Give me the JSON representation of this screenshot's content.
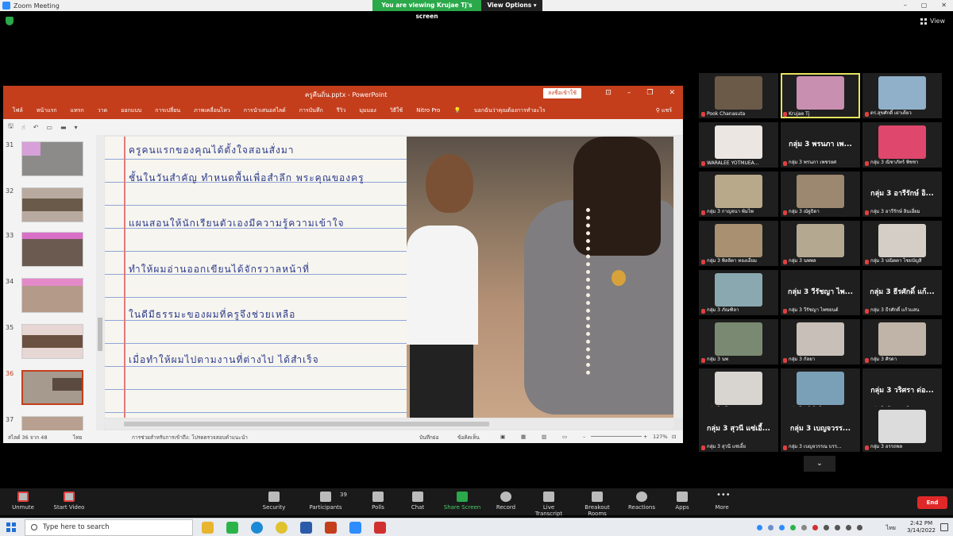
{
  "zoom": {
    "window_title": "Zoom Meeting",
    "viewing_banner": "You are viewing Krujae Tj's screen",
    "view_options": "View Options",
    "view_label": "View",
    "window_controls": [
      "–",
      "▢",
      "✕"
    ]
  },
  "ppt": {
    "file_title": "ครูคืนถิ่น.pptx  -  PowerPoint",
    "signin_button": "ลงชื่อเข้าใช้",
    "ribbon_tabs": [
      "ไฟล์",
      "หน้าแรก",
      "แทรก",
      "วาด",
      "ออกแบบ",
      "การเปลี่ยน",
      "ภาพเคลื่อนไหว",
      "การนำเสนอสไลด์",
      "การบันทึก",
      "รีวิว",
      "มุมมอง",
      "วิธีใช้",
      "Nitro Pro"
    ],
    "tell_me": "บอกฉันว่าคุณต้องการทำอะไร",
    "share_label": "แชร์",
    "slide_numbers": [
      "31",
      "32",
      "33",
      "34",
      "35",
      "36",
      "37"
    ],
    "handwriting_lines": [
      "ครูคนแรกของคุณได้ตั้งใจสอนสั่งมา",
      "ชั้นในวันสำคัญ ทำหนดพื้นเพื่อสำลึก พระคุณของครู",
      "แผนสอนให้นักเรียนตัวเองมีความรู้ความเข้าใจ",
      "ทำให้ผมอ่านออกเขียนได้จักรวาลหน้าที่",
      "ในดีมีธรรมะของผมที่ครูจึงช่วยเหลือ",
      "เมื่อทำให้ผมไปตามงานที่ต่างไป ได้สำเร็จ"
    ],
    "status_slide": "สไลด์ 36 จาก 48",
    "status_lang": "ไทย",
    "status_accessibility": "การช่วยสำหรับการเข้าถึง: โปรดตรวจสอบคำแนะนำ",
    "status_notes": "บันทึกย่อ",
    "status_comments": "ข้อคิดเห็น",
    "zoom_level": "127%"
  },
  "gallery": [
    {
      "name": "Pook Chanasuta",
      "big": "",
      "video": "#6b5a48"
    },
    {
      "name": "Krujae Tj",
      "big": "",
      "video": "#c98fb0",
      "active": true
    },
    {
      "name": "ดร.สุขศักดิ์ เผ่าเดียว",
      "big": "",
      "video": "#8fb0c8"
    },
    {
      "name": "WARALEE YOTMUEA...",
      "big": "",
      "video": "#ebe6e2"
    },
    {
      "name": "กลุ่ม 3 พรนภา เพชรยศ",
      "big": "กลุ่ม 3 พรนภา เพ...",
      "video": ""
    },
    {
      "name": "กลุ่ม 3 ณิชาภัทร์ พิชชา",
      "big": "",
      "video": "#e0476c"
    },
    {
      "name": "กลุ่ม 3 กาญจนา พ้มไพ",
      "big": "",
      "video": "#b8a98a"
    },
    {
      "name": "กลุ่ม 3 ณัฐธิดา",
      "big": "",
      "video": "#9c8870"
    },
    {
      "name": "กลุ่ม 3 อารีรักษ์ อินเอี่ยม",
      "big": "กลุ่ม 3 อารีรักษ์ อิ...",
      "video": ""
    },
    {
      "name": "กลุ่ม 3 พิลลิดา ทองเอี่ยม",
      "big": "",
      "video": "#a89070"
    },
    {
      "name": "กลุ่ม 3 นพพล",
      "big": "",
      "video": "#b4a890"
    },
    {
      "name": "กลุ่ม 3 ปณิตตา ไชยบัญสิ",
      "big": "",
      "video": "#d4cec6"
    },
    {
      "name": "กลุ่ม 3 ภัณฑิลา",
      "big": "",
      "video": "#8aa8b0"
    },
    {
      "name": "กลุ่ม 3 วีรัชญา ไพชยนต์",
      "big": "กลุ่ม 3 วีรัชญา ไพ...",
      "video": ""
    },
    {
      "name": "กลุ่ม 3 ธีรศักดิ์ แก้วแสน",
      "big": "กลุ่ม 3 ธีรศักดิ์ แก้...",
      "video": ""
    },
    {
      "name": "กลุ่ม 3 นพ",
      "big": "",
      "video": "#7a8a72"
    },
    {
      "name": "กลุ่ม 3 กัลยา",
      "big": "",
      "video": "#c8c0b8"
    },
    {
      "name": "กลุ่ม 3 ศิรดา",
      "big": "",
      "video": "#c0b4a8"
    },
    {
      "name": "กลุ่ม 3 สุภิศา",
      "big": "",
      "video": "#d8d4d0"
    },
    {
      "name": "กลุ่ม 3 จุฬารัตน์",
      "big": "",
      "video": "#7aa0b8"
    },
    {
      "name": "กลุ่ม 3 วริศรา ดอลิน",
      "big": "กลุ่ม 3 วริศรา ด่อ...",
      "video": ""
    },
    {
      "name": "กลุ่ม 3 สุวนี แซ่เอี้ย",
      "big": "กลุ่ม 3 สุวนี แซ่เอี้...",
      "video": ""
    },
    {
      "name": "กลุ่ม 3 เบญจวรรณ บรร...",
      "big": "กลุ่ม 3 เบญจวรร...",
      "video": ""
    },
    {
      "name": "กลุ่ม 3 อรรถพล",
      "big": "",
      "video": "#dcdcdc"
    }
  ],
  "toolbar": {
    "unmute": "Unmute",
    "start_video": "Start Video",
    "security": "Security",
    "participants": "Participants",
    "participants_count": "39",
    "polls": "Polls",
    "chat": "Chat",
    "share_screen": "Share Screen",
    "record": "Record",
    "live_transcript": "Live Transcript",
    "breakout_rooms": "Breakout Rooms",
    "reactions": "Reactions",
    "apps": "Apps",
    "more": "More",
    "end": "End"
  },
  "taskbar": {
    "search_placeholder": "Type here to search",
    "language": "ไทย",
    "time": "2:42 PM",
    "date": "3/14/2022"
  },
  "colors": {
    "ppt_accent": "#c43e1c",
    "share_green": "#2aa84a",
    "end_red": "#e02828",
    "active_speaker": "#e7e45e"
  }
}
